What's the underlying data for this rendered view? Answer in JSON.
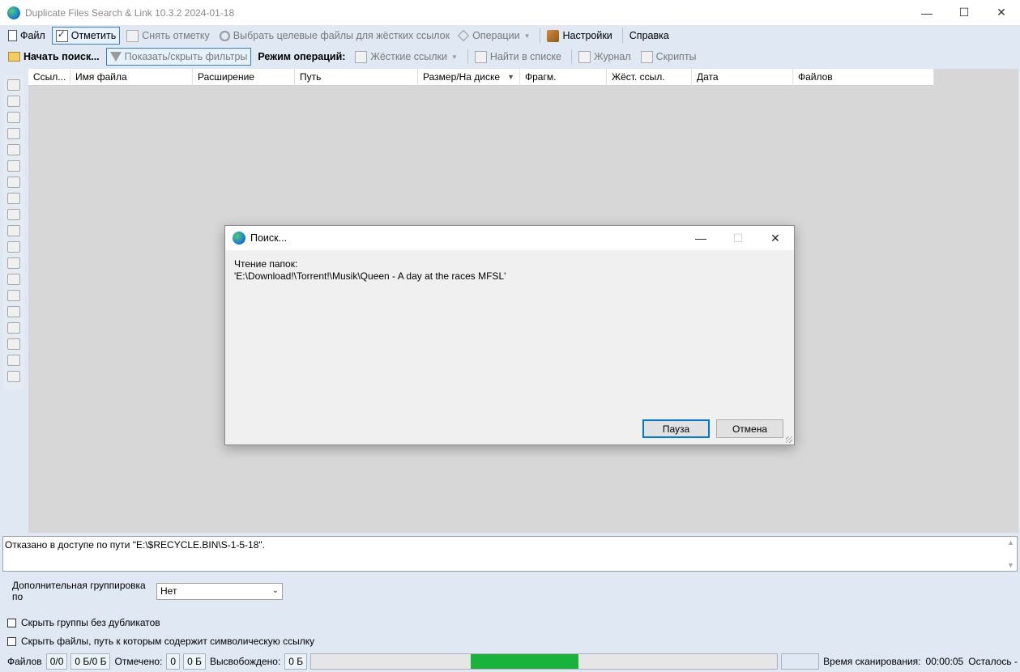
{
  "window": {
    "title": "Duplicate Files Search & Link 10.3.2 2024-01-18"
  },
  "menubar": [
    {
      "label": "Файл",
      "icon": "file-icon",
      "state": "normal"
    },
    {
      "label": "Отметить",
      "icon": "check-icon",
      "state": "pressed"
    },
    {
      "label": "Снять отметку",
      "icon": "uncheck-icon",
      "state": "disabled"
    },
    {
      "label": "Выбрать целевые файлы для жёстких ссылок",
      "icon": "gear-icon",
      "state": "disabled"
    },
    {
      "label": "Операции",
      "icon": "diamond-icon",
      "state": "disabled",
      "dropdown": true
    },
    {
      "label": "Настройки",
      "icon": "tools-icon",
      "state": "normal"
    },
    {
      "label": "Справка",
      "icon": "",
      "state": "normal"
    }
  ],
  "toolbar": [
    {
      "label": "Начать поиск...",
      "icon": "folder-search-icon",
      "state": "bold"
    },
    {
      "label": "Показать/скрыть фильтры",
      "icon": "filter-icon",
      "state": "pressed-disabled"
    },
    {
      "label": "Режим операций:",
      "icon": "",
      "state": "bold"
    },
    {
      "label": "Жёсткие ссылки",
      "icon": "hardlink-icon",
      "state": "disabled",
      "dropdown": true
    },
    {
      "label": "Найти в списке",
      "icon": "find-icon",
      "state": "disabled"
    },
    {
      "label": "Журнал",
      "icon": "log-icon",
      "state": "disabled"
    },
    {
      "label": "Скрипты",
      "icon": "script-icon",
      "state": "disabled"
    }
  ],
  "columns": [
    "Ссыл...",
    "Имя файла",
    "Расширение",
    "Путь",
    "Размер/На диске",
    "Фрагм.",
    "Жёст. ссыл.",
    "Дата",
    "Файлов"
  ],
  "dialog": {
    "title": "Поиск...",
    "line1": "Чтение папок:",
    "line2": "'E:\\Download!\\Torrent!\\Musik\\Queen - A day at the races MFSL'",
    "pause_label": "Пауза",
    "cancel_label": "Отмена"
  },
  "log": {
    "message": "Отказано в доступе по пути \"E:\\$RECYCLE.BIN\\S-1-5-18\"."
  },
  "grouping": {
    "label": "Дополнительная группировка по",
    "value": "Нет"
  },
  "options": {
    "hide_no_dupes": "Скрыть группы без дубликатов",
    "hide_symlinks": "Скрыть файлы, путь к которым содержит символическую ссылку"
  },
  "status": {
    "files_label": "Файлов",
    "files_count": "0/0",
    "files_size": "0 Б/0 Б",
    "marked_label": "Отмечено:",
    "marked_count": "0",
    "marked_size": "0 Б",
    "freed_label": "Высвобождено:",
    "freed_size": "0 Б",
    "scan_time_label": "Время сканирования:",
    "scan_time": "00:00:05",
    "remaining_label": "Осталось -"
  }
}
